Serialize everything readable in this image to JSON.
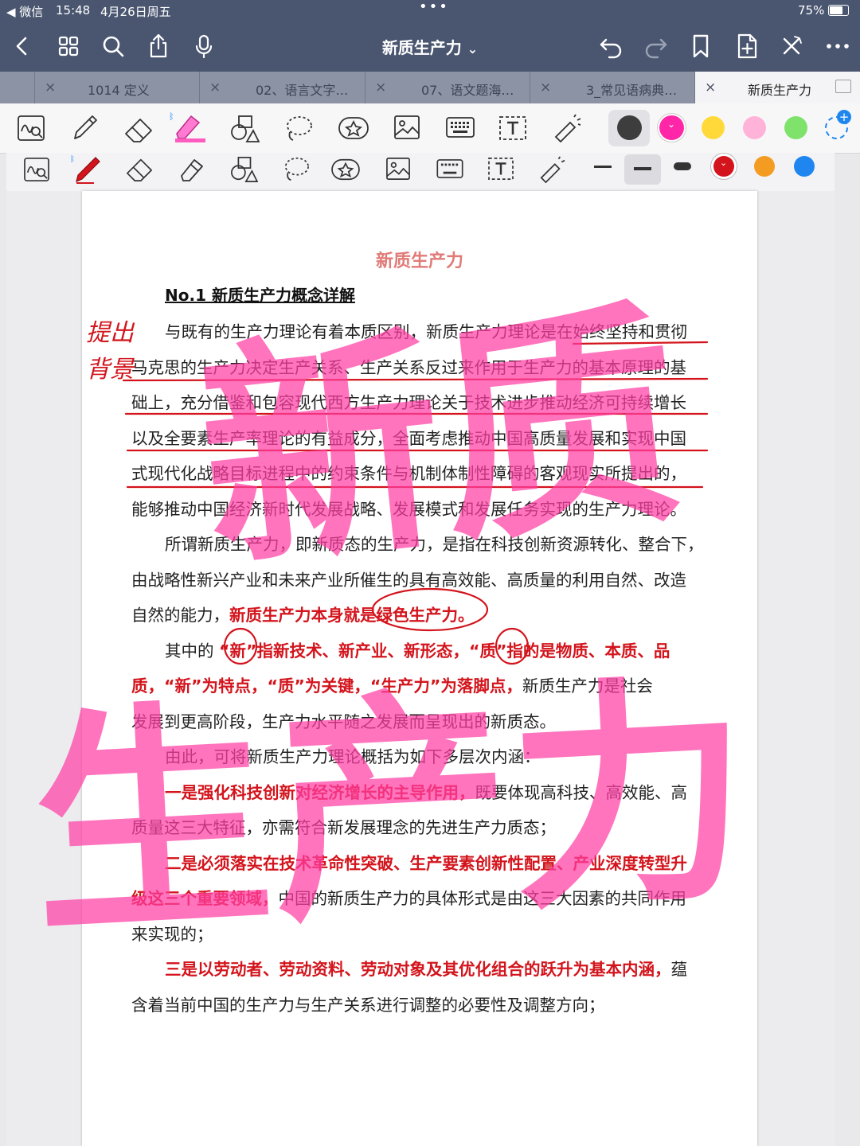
{
  "status": {
    "back_app": "◀ 微信",
    "time": "15:48",
    "date": "4月26日周五",
    "battery": "75%"
  },
  "nav": {
    "title": "新质生产力",
    "title_chevron": "⌄"
  },
  "tabs": [
    {
      "label": "1014 定义",
      "close": "×"
    },
    {
      "label": "02、语言文字…",
      "close": "×"
    },
    {
      "label": "07、语文题海…",
      "close": "×"
    },
    {
      "label": "3_常见语病典…",
      "close": "×"
    },
    {
      "label": "新质生产力",
      "close": "×"
    }
  ],
  "colors": {
    "nav_bg": "#4a5670",
    "highlighter_pink": "#ff3fa4",
    "pen_red": "#d3141c",
    "swatches_row1": [
      "#3d3d3d",
      "#ff27a8",
      "#ffd93a",
      "#ffb3d9",
      "#7ee26b"
    ],
    "swatches_row2": [
      "#222222",
      "#d4141c",
      "#f39c21",
      "#1f86f0"
    ]
  },
  "document": {
    "title": "新质生产力",
    "section_heading": "No.1  新质生产力概念详解",
    "lines": [
      {
        "segments": [
          {
            "t": "与既有的生产力理论有着本质区别，新质生产力理论是在始终坚持和贯彻",
            "red": false
          }
        ]
      },
      {
        "segments": [
          {
            "t": "马克思的生产力决定生产关系、生产关系反过来作用于生产力的基本原理的基",
            "red": false
          }
        ]
      },
      {
        "segments": [
          {
            "t": "础上，充分借鉴和包容现代西方生产力理论关于技术进步推动经济可持续增长",
            "red": false
          }
        ]
      },
      {
        "segments": [
          {
            "t": "以及全要素生产率理论的有益成分，全面考虑推动中国高质量发展和实现中国",
            "red": false
          }
        ]
      },
      {
        "segments": [
          {
            "t": "式现代化战略目标进程中的约束条件与机制体制性障碍的客观现实所提出的，",
            "red": false
          }
        ]
      },
      {
        "segments": [
          {
            "t": "能够推动中国经济新时代发展战略、发展模式和发展任务实现的生产力理论。",
            "red": false
          }
        ]
      },
      {
        "segments": [
          {
            "t": "所谓新质生产力，即新质态的生产力，是指在科技创新资源转化、整合下，",
            "red": false
          }
        ]
      },
      {
        "segments": [
          {
            "t": "由战略性新兴产业和未来产业所催生的具有高效能、高质量的利用自然、改造",
            "red": false
          }
        ]
      },
      {
        "segments": [
          {
            "t": "自然的能力，",
            "red": false
          },
          {
            "t": "新质生产力本身就是绿色生产力。",
            "red": true
          }
        ]
      },
      {
        "segments": [
          {
            "t": "其中的 ",
            "red": false
          },
          {
            "t": "“新”指新技术、新产业、新形态，“质”指的是物质、本质、品",
            "red": true
          }
        ]
      },
      {
        "segments": [
          {
            "t": "质，“新”为特点，“质”为关键，“生产力”为落脚点，",
            "red": true
          },
          {
            "t": "新质生产力是社会",
            "red": false
          }
        ]
      },
      {
        "segments": [
          {
            "t": "发展到更高阶段，生产力水平随之发展而呈现出的新质态。",
            "red": false
          }
        ]
      },
      {
        "segments": [
          {
            "t": "由此，可将新质生产力理论概括为如下多层次内涵：",
            "red": false
          }
        ]
      },
      {
        "segments": [
          {
            "t": "一是强化科技创新对经济增长的主导作用，",
            "red": true
          },
          {
            "t": "既要体现高科技、高效能、高",
            "red": false
          }
        ]
      },
      {
        "segments": [
          {
            "t": "质量这三大特征，亦需符合新发展理念的先进生产力质态；",
            "red": false
          }
        ]
      },
      {
        "segments": [
          {
            "t": "二是必须落实在技术革命性突破、生产要素创新性配置、产业深度转型升",
            "red": true
          }
        ]
      },
      {
        "segments": [
          {
            "t": "级这三个重要领域，",
            "red": true
          },
          {
            "t": "中国的新质生产力的具体形式是由这三大因素的共同作用",
            "red": false
          }
        ]
      },
      {
        "segments": [
          {
            "t": "来实现的；",
            "red": false
          }
        ]
      },
      {
        "segments": [
          {
            "t": "三是以劳动者、劳动资料、劳动对象及其优化组合的跃升为基本内涵，",
            "red": true
          },
          {
            "t": "蕴",
            "red": false
          }
        ]
      },
      {
        "segments": [
          {
            "t": "含着当前中国的生产力与生产关系进行调整的必要性及调整方向；",
            "red": false
          }
        ]
      }
    ],
    "handwriting": {
      "margin_note_1": "提出",
      "margin_note_2": "背景",
      "big_top": "新质",
      "big_bottom": "生产力"
    }
  }
}
